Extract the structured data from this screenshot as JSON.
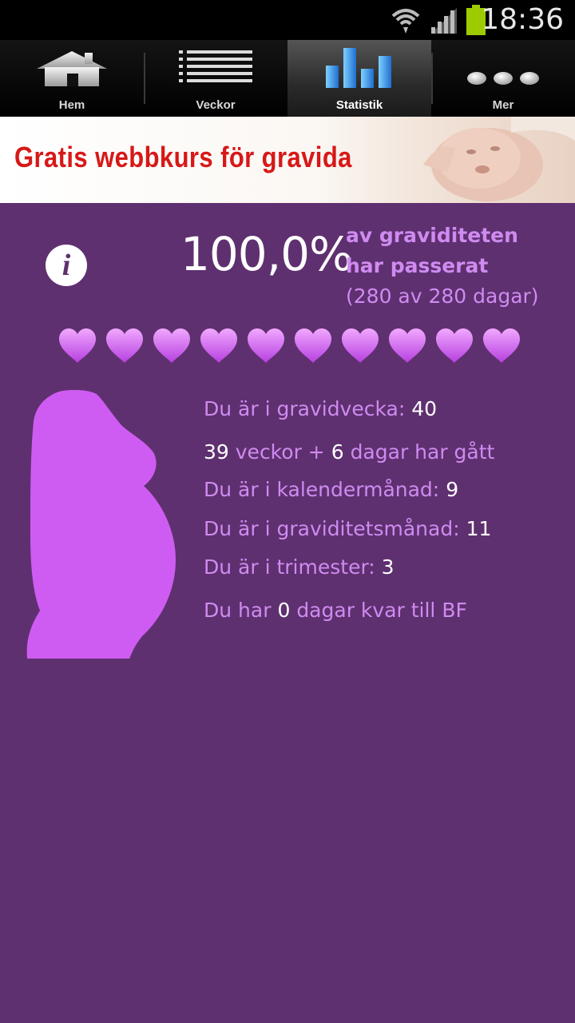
{
  "status_bar": {
    "time": "18:36"
  },
  "tabs": [
    {
      "label": "Hem",
      "icon": "home-icon"
    },
    {
      "label": "Veckor",
      "icon": "list-icon"
    },
    {
      "label": "Statistik",
      "icon": "bar-chart-icon",
      "active": true
    },
    {
      "label": "Mer",
      "icon": "more-icon"
    }
  ],
  "banner": {
    "text": "Gratis webbkurs för gravida"
  },
  "progress": {
    "percent": "100,0%",
    "line1": "av graviditeten",
    "line2": "har passerat",
    "days": "(280 av 280 dagar)",
    "hearts_filled": 10,
    "hearts_total": 10
  },
  "stats": {
    "gravidvecka_label": "Du är i gravidvecka:",
    "gravidvecka_value": "40",
    "weeks_value": "39",
    "weeks_label": "veckor +",
    "days_value": "6",
    "days_label": "dagar har gått",
    "kalendermanad_label": "Du är i kalendermånad:",
    "kalendermanad_value": "9",
    "graviditetsmanad_label": "Du är i graviditetsmånad:",
    "graviditetsmanad_value": "11",
    "trimester_label": "Du är i trimester:",
    "trimester_value": "3",
    "bf_prefix": "Du har",
    "bf_value": "0",
    "bf_suffix": "dagar kvar till BF"
  },
  "colors": {
    "background": "#5f3070",
    "accent": "#cf8bf0",
    "silhouette": "#cf5cf2",
    "banner_text": "#d71818"
  }
}
